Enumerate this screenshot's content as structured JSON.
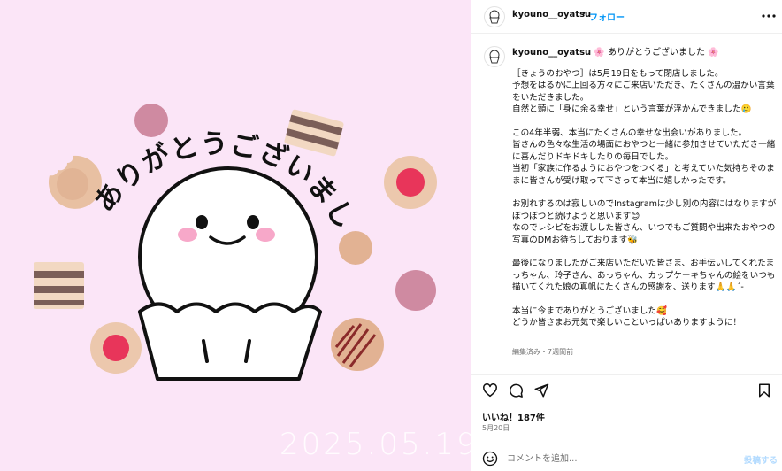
{
  "image": {
    "headline": "ありがとうございました",
    "date_stamp": "2025.05.19",
    "colors": {
      "background": "#fbe5f7",
      "cheek": "#f7a8c9",
      "cookie_pink": "#cf8aa1",
      "cookie_tan": "#e8c4a8",
      "jam_red": "#e8355a"
    }
  },
  "header": {
    "username": "kyouno__oyatsu",
    "separator": "•",
    "follow_label": "フォロー",
    "more_icon": "more-horizontal-icon"
  },
  "caption": {
    "username": "kyouno__oyatsu",
    "heading": " 🌸 ありがとうございました 🌸",
    "paragraphs": [
      "［きょうのおやつ］は5月19日をもって閉店しました。\n予想をはるかに上回る方々にご来店いただき、たくさんの温かい言葉をいただきました。\n自然と頭に「身に余る幸せ」という言葉が浮かんできました🥲",
      "この4年半弱、本当にたくさんの幸せな出会いがありました。\n皆さんの色々な生活の場面におやつと一緒に参加させていただき一緒に喜んだりドキドキしたりの毎日でした。\n当初「家族に作るようにおやつをつくる」と考えていた気持ちそのままに皆さんが受け取って下さって本当に嬉しかったです。",
      "お別れするのは寂しいのでInstagramは少し別の内容にはなりますがぼつぼつと続けようと思います😊\nなのでレシピをお渡しした皆さん、いつでもご質問や出来たおやつの写真のDMお待ちしております🐝",
      "最後になりましたがご来店いただいた皆さま、お手伝いしてくれたまっちゃん、玲子さん、あっちゃん、カップケーキちゃんの絵をいつも描いてくれた娘の真帆にたくさんの感謝を、送ります🙏🙏ˊ-",
      "本当に今までありがとうございました🥰\nどうか皆さまお元気で楽しいこといっぱいありますように！"
    ],
    "meta": "編集済み・7週間前"
  },
  "actions": {
    "icons": [
      "heart-icon",
      "comment-icon",
      "share-icon",
      "bookmark-icon"
    ],
    "likes": "いいね！187件",
    "date": "5月20日"
  },
  "comment": {
    "placeholder": "コメントを追加...",
    "post_label": "投稿する",
    "emoji_icon": "smiley-icon"
  }
}
